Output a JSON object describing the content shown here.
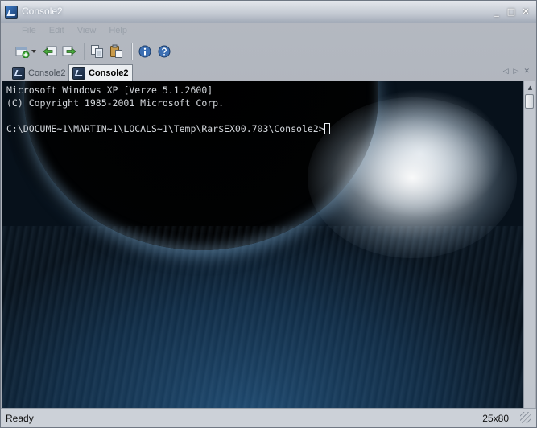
{
  "window": {
    "title": "Console2",
    "controls": [
      "_",
      "□",
      "✕"
    ]
  },
  "menu": {
    "items": [
      "File",
      "Edit",
      "View",
      "Help"
    ]
  },
  "toolbar": {
    "icons": [
      "new-tab-icon",
      "previous-tab-icon",
      "next-tab-icon",
      "copy-icon",
      "paste-icon",
      "settings-icon",
      "help-icon"
    ]
  },
  "tabs": [
    {
      "label": "Console2",
      "active": false
    },
    {
      "label": "Console2",
      "active": true
    }
  ],
  "console": {
    "lines": [
      "Microsoft Windows XP [Verze 5.1.2600]",
      "(C) Copyright 1985-2001 Microsoft Corp.",
      "",
      "C:\\DOCUME~1\\MARTIN~1\\LOCALS~1\\Temp\\Rar$EX00.703\\Console2>"
    ]
  },
  "status": {
    "text": "Ready",
    "size": "25x80"
  },
  "colors": {
    "console_text": "#d3d7dc",
    "title_text": "#f6f8fb"
  }
}
